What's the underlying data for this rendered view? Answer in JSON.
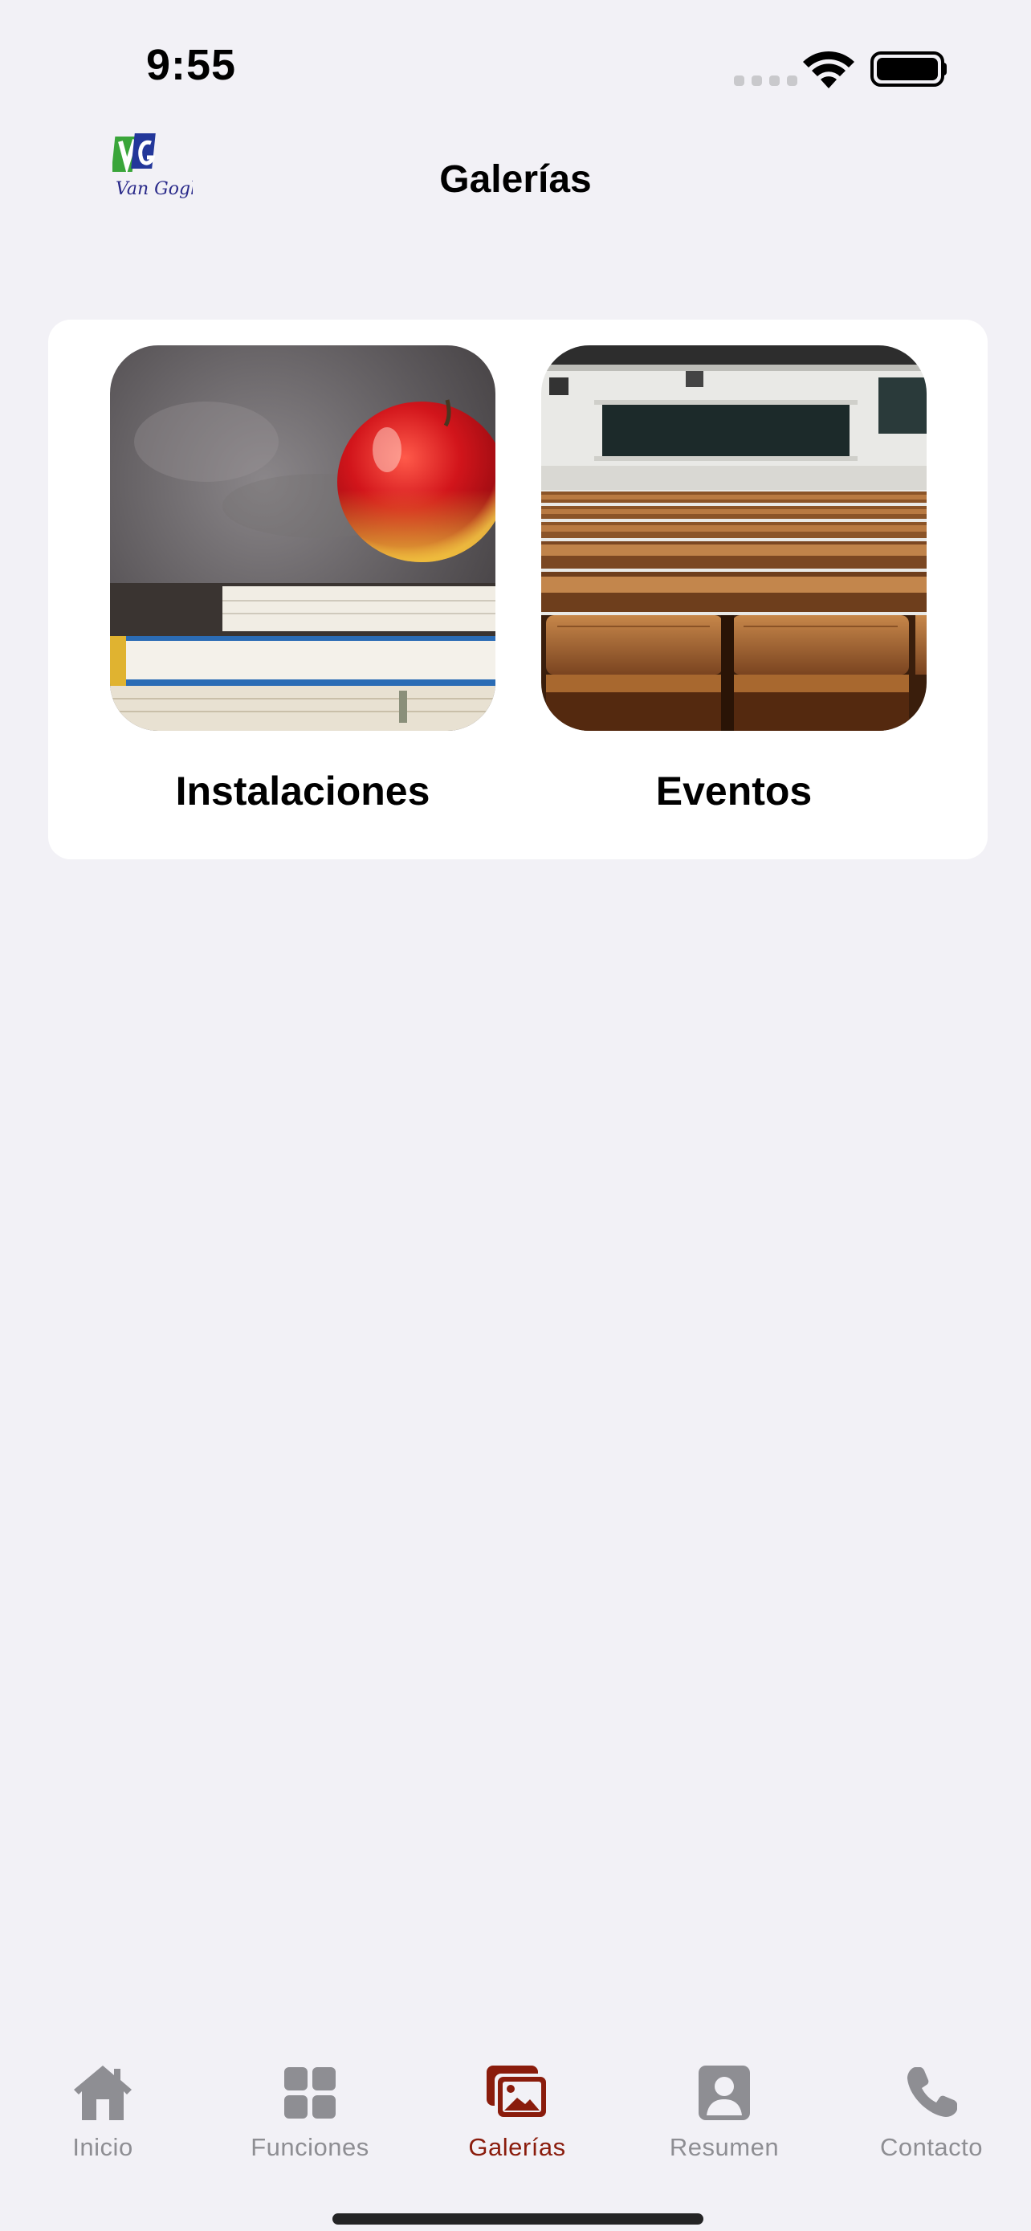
{
  "status_bar": {
    "time": "9:55"
  },
  "header": {
    "title": "Galerías",
    "logo_text": "Van Gogh"
  },
  "gallery": {
    "items": [
      {
        "label": "Instalaciones",
        "image": "apple-on-books-photo"
      },
      {
        "label": "Eventos",
        "image": "lecture-hall-seats-photo"
      }
    ]
  },
  "tab_bar": {
    "active_color": "#8a1c0c",
    "inactive_color": "#8e8e93",
    "tabs": [
      {
        "label": "Inicio",
        "icon": "house-icon",
        "active": false
      },
      {
        "label": "Funciones",
        "icon": "grid-icon",
        "active": false
      },
      {
        "label": "Galerías",
        "icon": "photo-gallery-icon",
        "active": true
      },
      {
        "label": "Resumen",
        "icon": "person-card-icon",
        "active": false
      },
      {
        "label": "Contacto",
        "icon": "phone-icon",
        "active": false
      }
    ]
  }
}
